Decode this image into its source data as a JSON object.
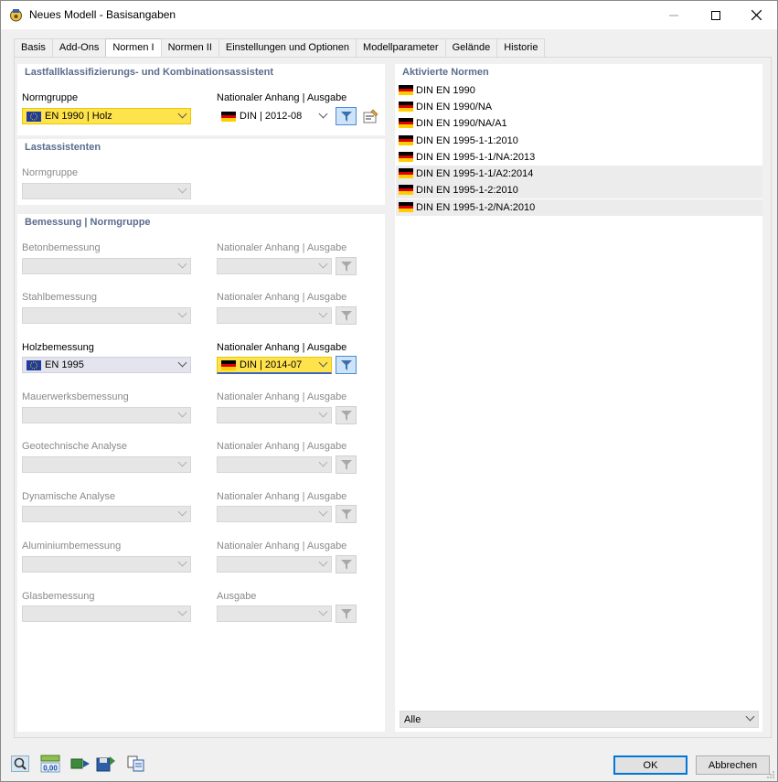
{
  "window": {
    "title": "Neues Modell - Basisangaben"
  },
  "tabs": [
    {
      "label": "Basis"
    },
    {
      "label": "Add-Ons"
    },
    {
      "label": "Normen I"
    },
    {
      "label": "Normen II"
    },
    {
      "label": "Einstellungen und Optionen"
    },
    {
      "label": "Modellparameter"
    },
    {
      "label": "Gelände"
    },
    {
      "label": "Historie"
    }
  ],
  "lastfall": {
    "title": "Lastfallklassifizierungs- und Kombinationsassistent",
    "normgruppe_label": "Normgruppe",
    "normgruppe_value": "EN 1990 | Holz",
    "anhang_label": "Nationaler Anhang | Ausgabe",
    "anhang_value": "DIN | 2012-08"
  },
  "lastassistenten": {
    "title": "Lastassistenten",
    "normgruppe_label": "Normgruppe"
  },
  "bemessung": {
    "title": "Bemessung | Normgruppe",
    "rows": [
      {
        "label": "Betonbemessung",
        "anhang_label": "Nationaler Anhang | Ausgabe"
      },
      {
        "label": "Stahlbemessung",
        "anhang_label": "Nationaler Anhang | Ausgabe"
      },
      {
        "label": "Holzbemessung",
        "anhang_label": "Nationaler Anhang | Ausgabe",
        "value": "EN 1995",
        "anhang_value": "DIN | 2014-07"
      },
      {
        "label": "Mauerwerksbemessung",
        "anhang_label": "Nationaler Anhang | Ausgabe"
      },
      {
        "label": "Geotechnische Analyse",
        "anhang_label": "Nationaler Anhang | Ausgabe"
      },
      {
        "label": "Dynamische Analyse",
        "anhang_label": "Nationaler Anhang | Ausgabe"
      },
      {
        "label": "Aluminiumbemessung",
        "anhang_label": "Nationaler Anhang | Ausgabe"
      },
      {
        "label": "Glasbemessung",
        "anhang_label": "Ausgabe"
      }
    ]
  },
  "aktivierte": {
    "title": "Aktivierte Normen",
    "items": [
      "DIN EN 1990",
      "DIN EN 1990/NA",
      "DIN EN 1990/NA/A1",
      "DIN EN 1995-1-1:2010",
      "DIN EN 1995-1-1/NA:2013",
      "DIN EN 1995-1-1/A2:2014",
      "DIN EN 1995-1-2:2010",
      "DIN EN 1995-1-2/NA:2010"
    ],
    "filter_value": "Alle"
  },
  "footer": {
    "zero_label": "0,00",
    "ok_label": "OK",
    "cancel_label": "Abbrechen"
  },
  "colors": {
    "accent": "#5a6d8e",
    "highlight_yellow": "#ffe34d",
    "flag_black": "#000000",
    "flag_red": "#dd0000",
    "flag_gold": "#ffce00"
  }
}
